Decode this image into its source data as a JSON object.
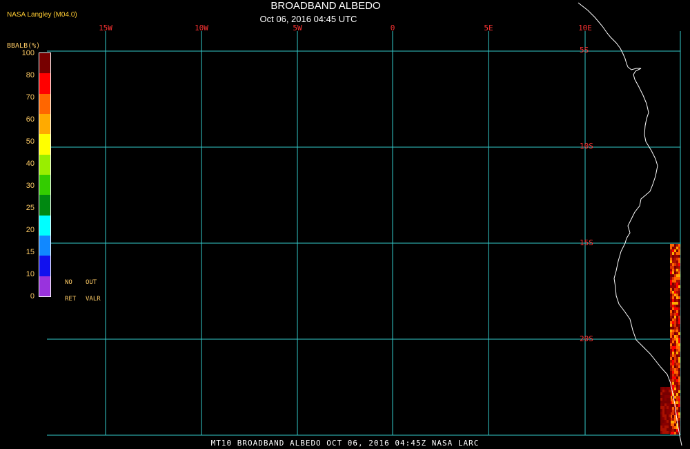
{
  "header": {
    "credit": "NASA Langley (M04.0)",
    "title": "BROADBAND ALBEDO",
    "subtitle": "Oct 06, 2016 04:45 UTC"
  },
  "footer": {
    "caption": "MT10  BROADBAND ALBEDO  OCT 06, 2016 04:45Z  NASA LARC"
  },
  "colors": {
    "grid": "#33cccc",
    "axis_labels": "#ff3333",
    "text_header": "#ffffff",
    "text_credit": "#ffcc33",
    "text_colorbar": "#ffcc66",
    "text_footer": "#ffffff",
    "coastline": "#ffffff"
  },
  "map": {
    "lon_labels": [
      "15W",
      "10W",
      "5W",
      "0",
      "5E",
      "10E"
    ],
    "lat_labels": [
      "5S",
      "10S",
      "15S",
      "20S"
    ]
  },
  "colorbar": {
    "title": "BBALB(%)",
    "ticks": [
      "0",
      "10",
      "15",
      "20",
      "25",
      "30",
      "40",
      "50",
      "60",
      "70",
      "80",
      "100"
    ],
    "colors": [
      "#9933dd",
      "#1111ee",
      "#1188ff",
      "#00ffff",
      "#008811",
      "#33cc00",
      "#99ee00",
      "#ffff00",
      "#ffaa00",
      "#ff6600",
      "#ff0000",
      "#770000"
    ],
    "no_label": "NO",
    "ret_label": "RET",
    "out_label": "OUT",
    "valr_label": "VALR"
  }
}
